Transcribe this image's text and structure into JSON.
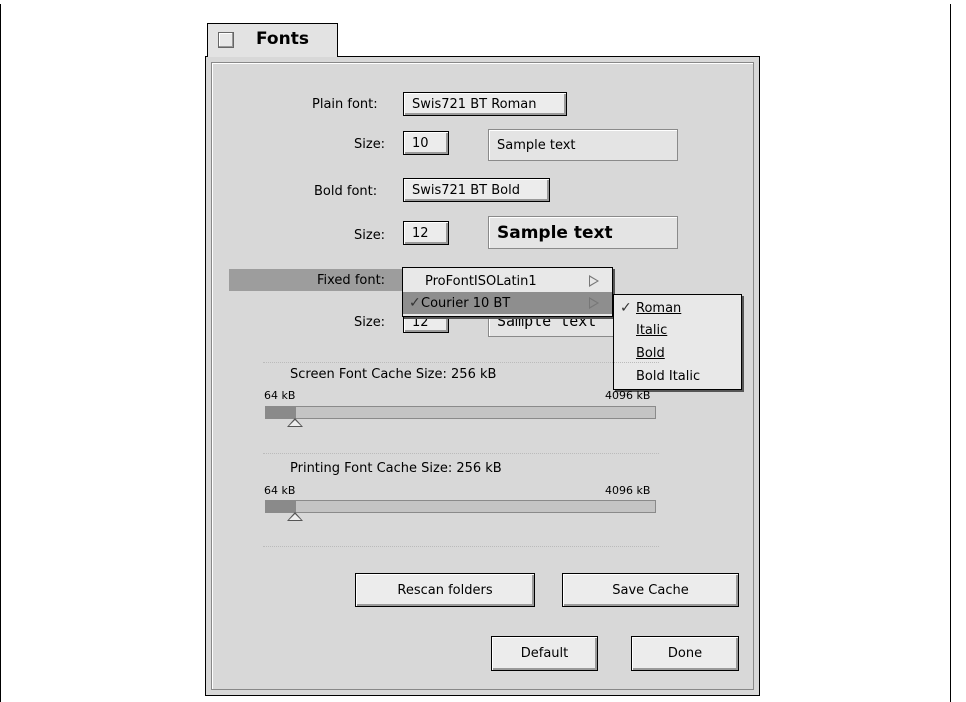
{
  "tab": {
    "title": "Fonts"
  },
  "plain": {
    "label": "Plain font:",
    "value": "Swis721 BT Roman",
    "size_label": "Size:",
    "size": "10",
    "sample": "Sample text"
  },
  "bold": {
    "label": "Bold font:",
    "value": "Swis721 BT Bold",
    "size_label": "Size:",
    "size": "12",
    "sample": "Sample text"
  },
  "fixed": {
    "label": "Fixed font:",
    "size_label": "Size:",
    "size": "12",
    "sample": "Sample text"
  },
  "font_menu": {
    "items": [
      {
        "label": "ProFontISOLatin1",
        "checked": false,
        "selected": false
      },
      {
        "label": "Courier 10 BT",
        "checked": true,
        "selected": true
      }
    ]
  },
  "style_menu": {
    "items": [
      {
        "label": "Roman",
        "checked": true
      },
      {
        "label": "Italic",
        "checked": false
      },
      {
        "label": "Bold",
        "checked": false
      },
      {
        "label": "Bold Italic",
        "checked": false
      }
    ]
  },
  "screen_cache": {
    "label": "Screen Font Cache Size: 256 kB",
    "min": "64 kB",
    "max": "4096 kB",
    "value_kb": 256,
    "min_kb": 64,
    "max_kb": 4096
  },
  "print_cache": {
    "label": "Printing Font Cache Size: 256 kB",
    "min": "64 kB",
    "max": "4096 kB",
    "value_kb": 256,
    "min_kb": 64,
    "max_kb": 4096
  },
  "buttons": {
    "rescan": "Rescan folders",
    "save_cache": "Save Cache",
    "default": "Default",
    "done": "Done"
  },
  "icons": {
    "check": "✓"
  }
}
